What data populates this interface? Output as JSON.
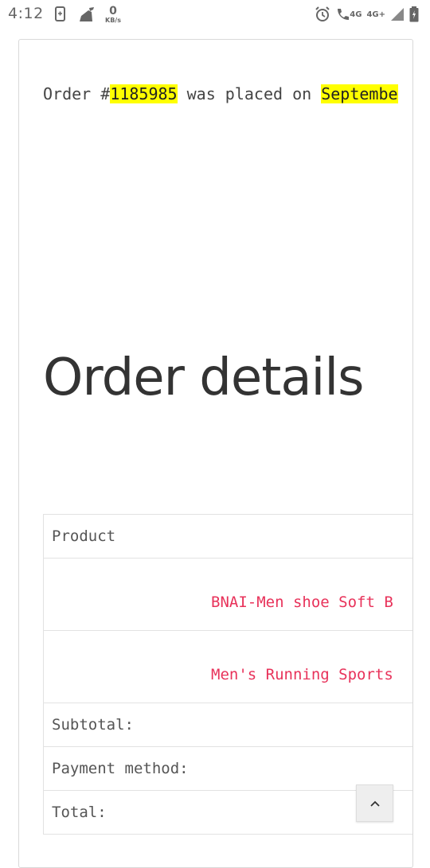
{
  "status_bar": {
    "time": "4:12",
    "net_speed": {
      "value": "0",
      "unit": "KB/s"
    },
    "icons_left": [
      "screen-record-icon",
      "cleaner-icon"
    ],
    "icons_right": [
      "alarm-icon",
      "call-4g-icon",
      "signal-icon",
      "battery-icon"
    ],
    "network_labels": [
      "4G",
      "4G+"
    ]
  },
  "order": {
    "prefix": "Order #",
    "number": "1185985",
    "middle": " was placed on ",
    "date_visible": "Septembe"
  },
  "details": {
    "heading": "Order details",
    "table": {
      "header": "Product",
      "items": [
        {
          "name": "BNAI-Men shoe Soft B"
        },
        {
          "name": "Men's Running Sports"
        }
      ],
      "footer_labels": [
        "Subtotal:",
        "Payment method:",
        "Total:"
      ]
    }
  },
  "scroll_top": {
    "icon": "chevron-up-icon"
  },
  "colors": {
    "highlight": "#ffff00",
    "link": "#e8325a",
    "text": "#444444",
    "border": "#e2e2e2"
  }
}
